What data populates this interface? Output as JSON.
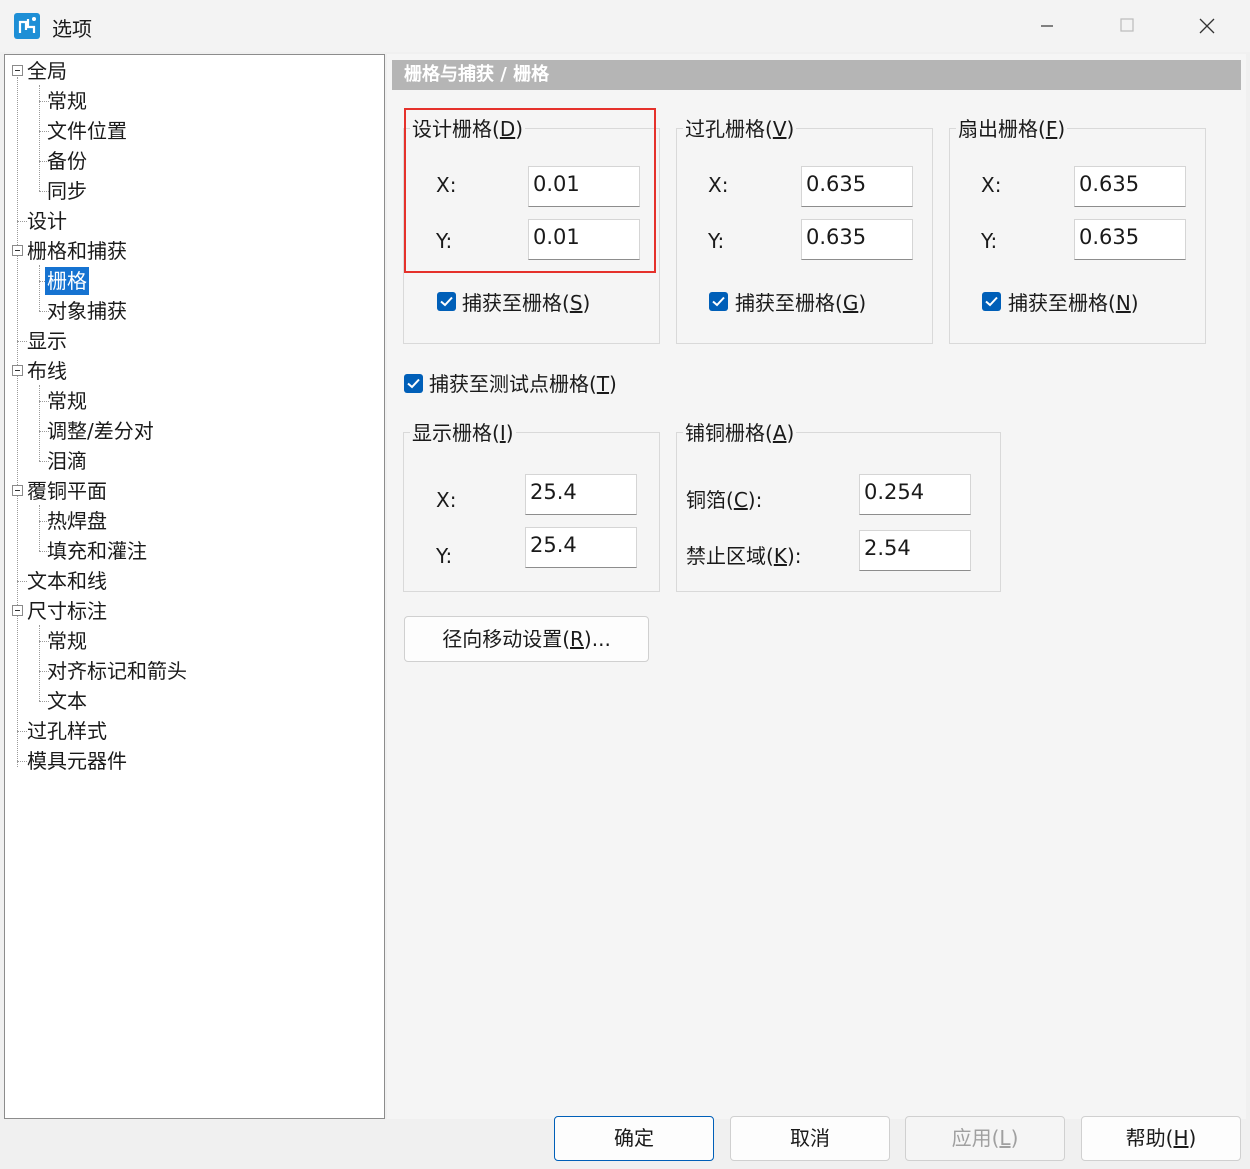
{
  "window": {
    "title": "选项"
  },
  "tree": {
    "items": [
      {
        "label": "全局"
      },
      {
        "label": "常规"
      },
      {
        "label": "文件位置"
      },
      {
        "label": "备份"
      },
      {
        "label": "同步"
      },
      {
        "label": "设计"
      },
      {
        "label": "栅格和捕获"
      },
      {
        "label": "栅格"
      },
      {
        "label": "对象捕获"
      },
      {
        "label": "显示"
      },
      {
        "label": "布线"
      },
      {
        "label": "常规"
      },
      {
        "label": "调整/差分对"
      },
      {
        "label": "泪滴"
      },
      {
        "label": "覆铜平面"
      },
      {
        "label": "热焊盘"
      },
      {
        "label": "填充和灌注"
      },
      {
        "label": "文本和线"
      },
      {
        "label": "尺寸标注"
      },
      {
        "label": "常规"
      },
      {
        "label": "对齐标记和箭头"
      },
      {
        "label": "文本"
      },
      {
        "label": "过孔样式"
      },
      {
        "label": "模具元器件"
      }
    ]
  },
  "header": {
    "title": "栅格与捕获 / 栅格"
  },
  "design_grid": {
    "label": "设计栅格(",
    "key": "D",
    "x_label": "X:",
    "x_value": "0.01",
    "y_label": "Y:",
    "y_value": "0.01",
    "snap_label": "捕获至栅格(",
    "snap_key": "S"
  },
  "via_grid": {
    "label": "过孔栅格(",
    "key": "V",
    "x_label": "X:",
    "x_value": "0.635",
    "y_label": "Y:",
    "y_value": "0.635",
    "snap_label": "捕获至栅格(",
    "snap_key": "G"
  },
  "fanout_grid": {
    "label": "扇出栅格(",
    "key": "F",
    "x_label": "X:",
    "x_value": "0.635",
    "y_label": "Y:",
    "y_value": "0.635",
    "snap_label": "捕获至栅格(",
    "snap_key": "N"
  },
  "testpoint": {
    "label": "捕获至测试点栅格(",
    "key": "T"
  },
  "display_grid": {
    "label": "显示栅格(",
    "key": "I",
    "x_label": "X:",
    "x_value": "25.4",
    "y_label": "Y:",
    "y_value": "25.4"
  },
  "pour_grid": {
    "label": "铺铜栅格(",
    "key": "A",
    "copper_label": "铜箔(",
    "copper_key": "C",
    "copper_value": "0.254",
    "keepout_label": "禁止区域(",
    "keepout_key": "K",
    "keepout_value": "2.54"
  },
  "radial": {
    "label": "径向移动设置(",
    "key": "R",
    "suffix": ")..."
  },
  "buttons": {
    "ok": "确定",
    "cancel": "取消",
    "apply": "应用(",
    "apply_key": "L",
    "help": "帮助(",
    "help_key": "H"
  },
  "colors": {
    "selection": "#1673d1",
    "checkbox": "#005fb8",
    "highlight": "#e5312b"
  }
}
